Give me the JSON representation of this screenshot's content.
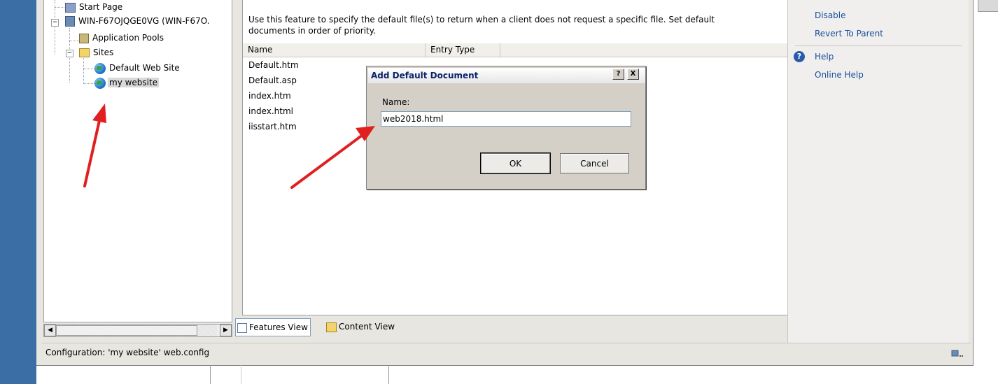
{
  "tree": {
    "items": [
      {
        "label": "Start Page"
      },
      {
        "label": "WIN-F67OJQGE0VG (WIN-F67O."
      },
      {
        "label": "Application Pools"
      },
      {
        "label": "Sites"
      },
      {
        "label": "Default Web Site"
      },
      {
        "label": "my website"
      }
    ],
    "expand_minus": "−"
  },
  "center": {
    "description": "Use this feature to specify the default file(s) to return when a client does not request a specific file. Set default documents in order of priority.",
    "columns": [
      "Name",
      "Entry Type"
    ],
    "rows": [
      "Default.htm",
      "Default.asp",
      "index.htm",
      "index.html",
      "iisstart.htm"
    ]
  },
  "views": {
    "features_view": "Features View",
    "content_view": "Content View"
  },
  "actions": {
    "disable": "Disable",
    "revert": "Revert To Parent",
    "help": "Help",
    "online_help": "Online Help",
    "help_glyph": "?"
  },
  "status": {
    "text": "Configuration: 'my website' web.config"
  },
  "dialog": {
    "title": "Add Default Document",
    "help_btn": "?",
    "close_btn": "X",
    "name_label": "Name:",
    "name_value": "web2018.html",
    "ok": "OK",
    "cancel": "Cancel"
  },
  "scroll": {
    "left_arrow": "◀",
    "right_arrow": "▶"
  },
  "colors": {
    "desktop": "#3a6ea5",
    "link": "#1a4f9c",
    "arrow": "#e02020"
  }
}
